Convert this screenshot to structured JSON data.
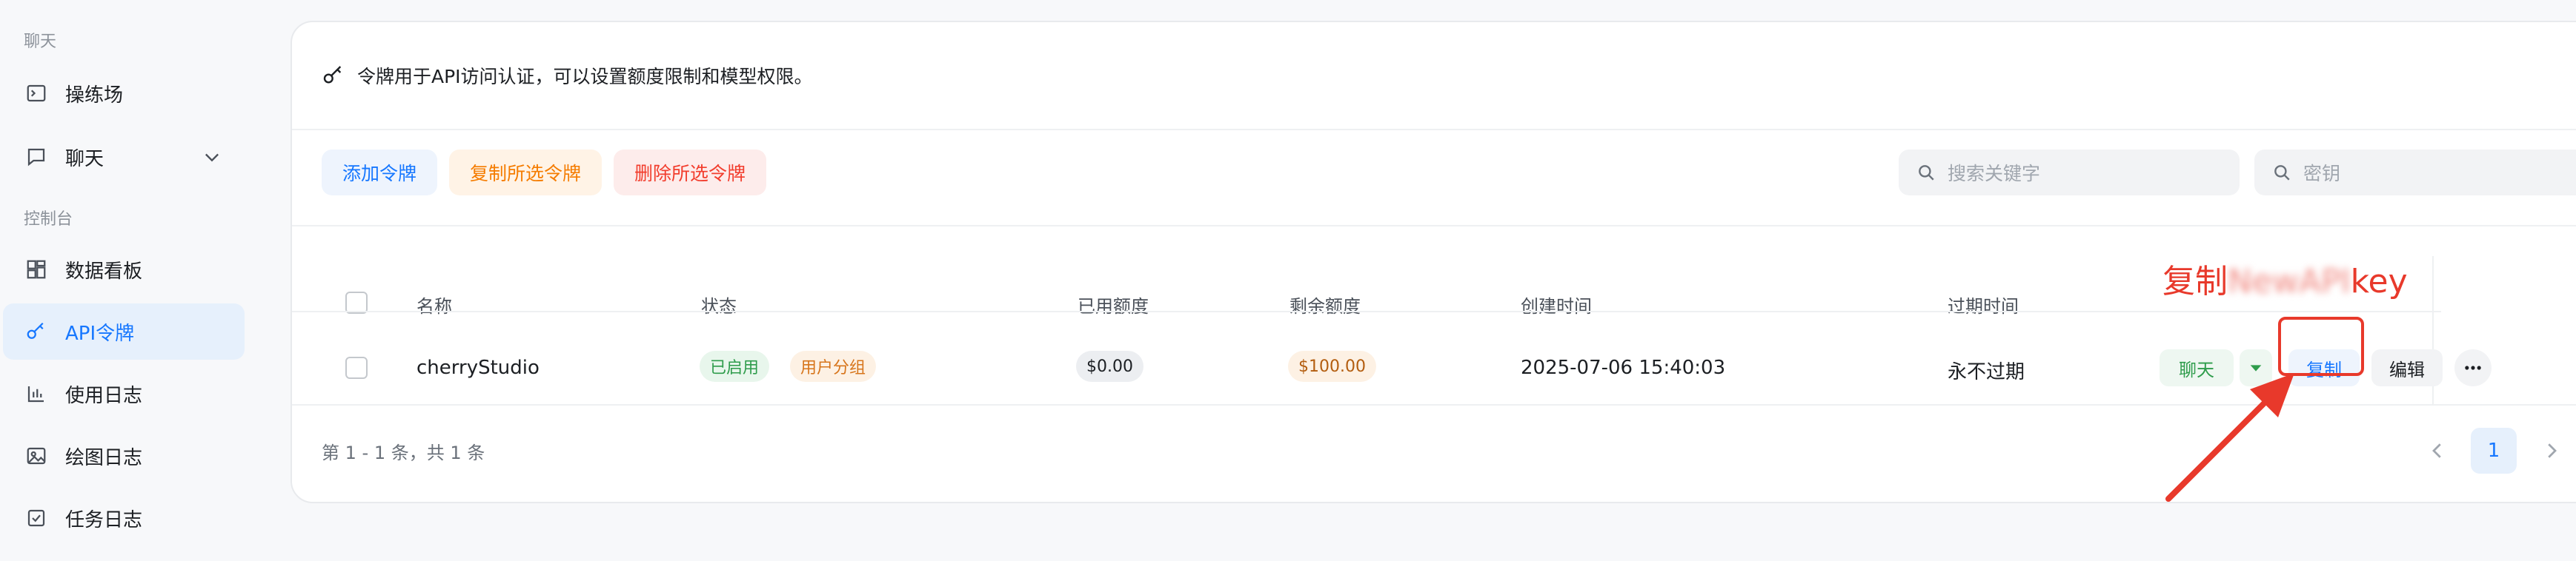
{
  "sidebar": {
    "sections": [
      {
        "label": "聊天"
      },
      {
        "label": "控制台"
      }
    ],
    "items": [
      {
        "label": "操练场",
        "icon": "terminal-icon"
      },
      {
        "label": "聊天",
        "icon": "chat-bubble-icon"
      },
      {
        "label": "数据看板",
        "icon": "dashboard-icon"
      },
      {
        "label": "API令牌",
        "icon": "key-icon",
        "active": true
      },
      {
        "label": "使用日志",
        "icon": "bar-chart-icon"
      },
      {
        "label": "绘图日志",
        "icon": "image-icon"
      },
      {
        "label": "任务日志",
        "icon": "checklist-icon"
      }
    ]
  },
  "main": {
    "info": "令牌用于API访问认证，可以设置额度限制和模型权限。",
    "toolbar": {
      "add_label": "添加令牌",
      "copy_selected_label": "复制所选令牌",
      "delete_selected_label": "删除所选令牌"
    },
    "search": {
      "keyword_placeholder": "搜索关键字",
      "key_placeholder": "密钥"
    },
    "table": {
      "headers": {
        "name": "名称",
        "status": "状态",
        "used": "已用额度",
        "remaining": "剩余额度",
        "created": "创建时间",
        "expires": "过期时间"
      },
      "rows": [
        {
          "name": "cherryStudio",
          "status": "已启用",
          "group": "用户分组",
          "used": "$0.00",
          "remaining": "$100.00",
          "created": "2025-07-06 15:40:03",
          "expires": "永不过期",
          "actions": {
            "chat": "聊天",
            "copy": "复制",
            "edit": "编辑"
          }
        }
      ]
    },
    "pagination": {
      "summary": "第 1 - 1 条，共 1 条",
      "current_page": "1"
    }
  },
  "annotation": {
    "prefix": "复制",
    "blurred": "NewAPI",
    "suffix": "key"
  },
  "colors": {
    "accent": "#1677ff",
    "annotation_red": "#e8392b",
    "orange": "#f57c00",
    "danger": "#f23d2d",
    "success": "#2e9c4b"
  }
}
